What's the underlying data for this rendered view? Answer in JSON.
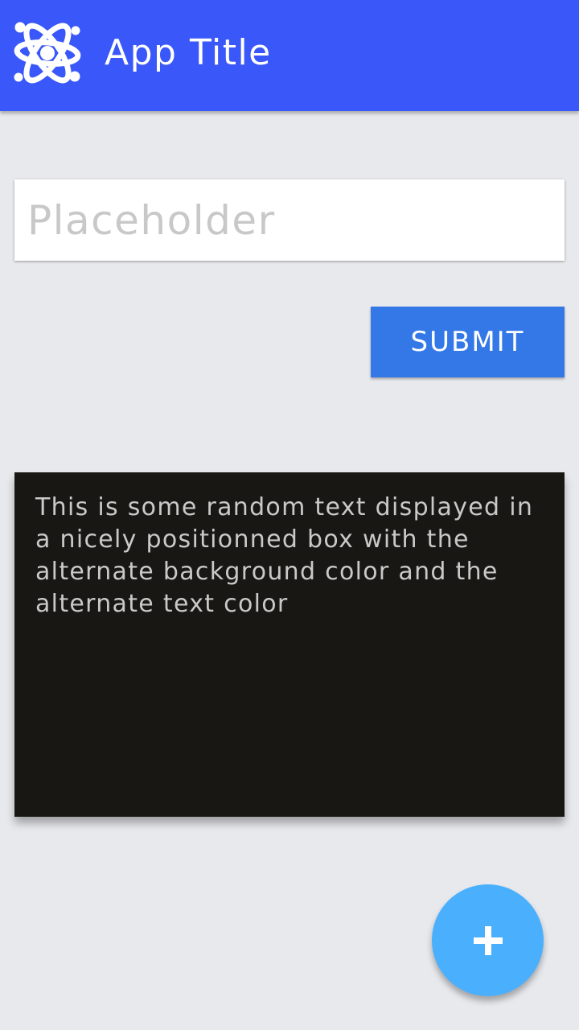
{
  "app_bar": {
    "title": "App Title",
    "logo_icon": "atom-icon",
    "background_color": "#3a57fa"
  },
  "form": {
    "input": {
      "value": "",
      "placeholder": "Placeholder"
    },
    "submit_label": "SUBMIT",
    "submit_color": "#3478e8"
  },
  "text_box": {
    "content": "This is some random text displayed in a nicely positionned box with the alternate background color and the alternate text color",
    "background_color": "#181713",
    "text_color": "#c9c9c9"
  },
  "fab": {
    "icon": "plus-icon",
    "color": "#4ab0fd"
  },
  "page": {
    "background_color": "#e8e9ed"
  }
}
